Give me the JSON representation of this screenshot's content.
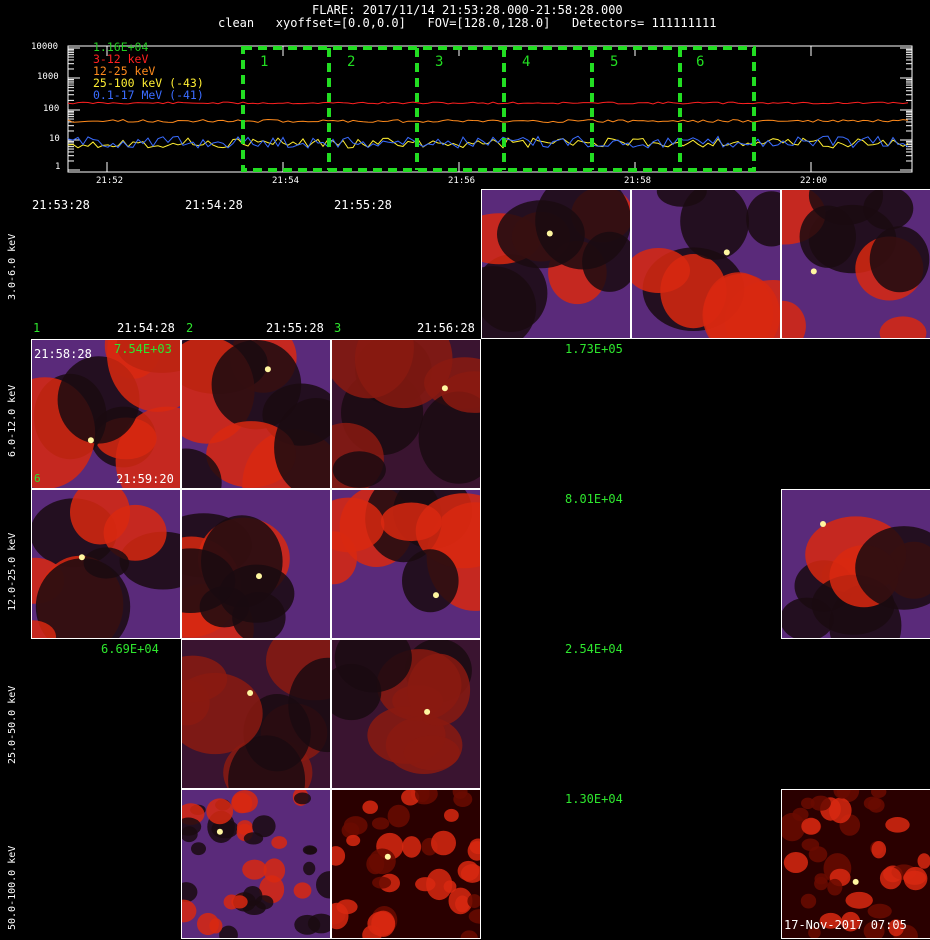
{
  "header": {
    "line1": "FLARE: 2017/11/14 21:53:28.000-21:58:28.000",
    "line2": "clean   xyoffset=[0.0,0.0]   FOV=[128.0,128.0]   Detectors= 111111111"
  },
  "lightcurve": {
    "y_ticks": [
      "10000",
      "1000",
      "100",
      "10",
      "1"
    ],
    "x_ticks": [
      "21:52",
      "21:54",
      "21:56",
      "21:58",
      "22:00"
    ],
    "legend": [
      {
        "text": "1.16E+04",
        "color": "#22cc22"
      },
      {
        "text": "3-12 keV",
        "color": "#ff2020"
      },
      {
        "text": "12-25 keV",
        "color": "#ff8a1c"
      },
      {
        "text": "25-100 keV (-43)",
        "color": "#ffee33"
      },
      {
        "text": "0.1-17 MeV (-41)",
        "color": "#3a6cff"
      }
    ],
    "interval_labels": [
      "1",
      "2",
      "3",
      "4",
      "5",
      "6"
    ]
  },
  "rows": [
    {
      "label": "3.0-6.0 keV"
    },
    {
      "label": "6.0-12.0 keV"
    },
    {
      "label": "12.0-25.0 keV"
    },
    {
      "label": "25.0-50.0 keV"
    },
    {
      "label": "50.0-100.0 keV"
    }
  ],
  "times": {
    "t0": "21:53:28",
    "t1": "21:54:28",
    "t2": "21:55:28",
    "row1_t1": "21:54:28",
    "row1_t2": "21:55:28",
    "row1_t3": "21:56:28",
    "first_cell_top": "21:58:28",
    "first_cell_bottom": "21:59:20"
  },
  "interval_marks": {
    "n1": "1",
    "n2": "2",
    "n3": "3",
    "n6": "6"
  },
  "max_values": {
    "r1c0": "7.54E+03",
    "r1c3": "1.73E+05",
    "r2c3": "8.01E+04",
    "r3c0": "6.69E+04",
    "r3c3": "2.54E+04",
    "r4c3": "1.30E+04"
  },
  "footer": {
    "timestamp": "17-Nov-2017 07:05"
  },
  "colors": {
    "background": "#000000",
    "interval_box": "#22dd22",
    "axis": "#ffffff"
  }
}
